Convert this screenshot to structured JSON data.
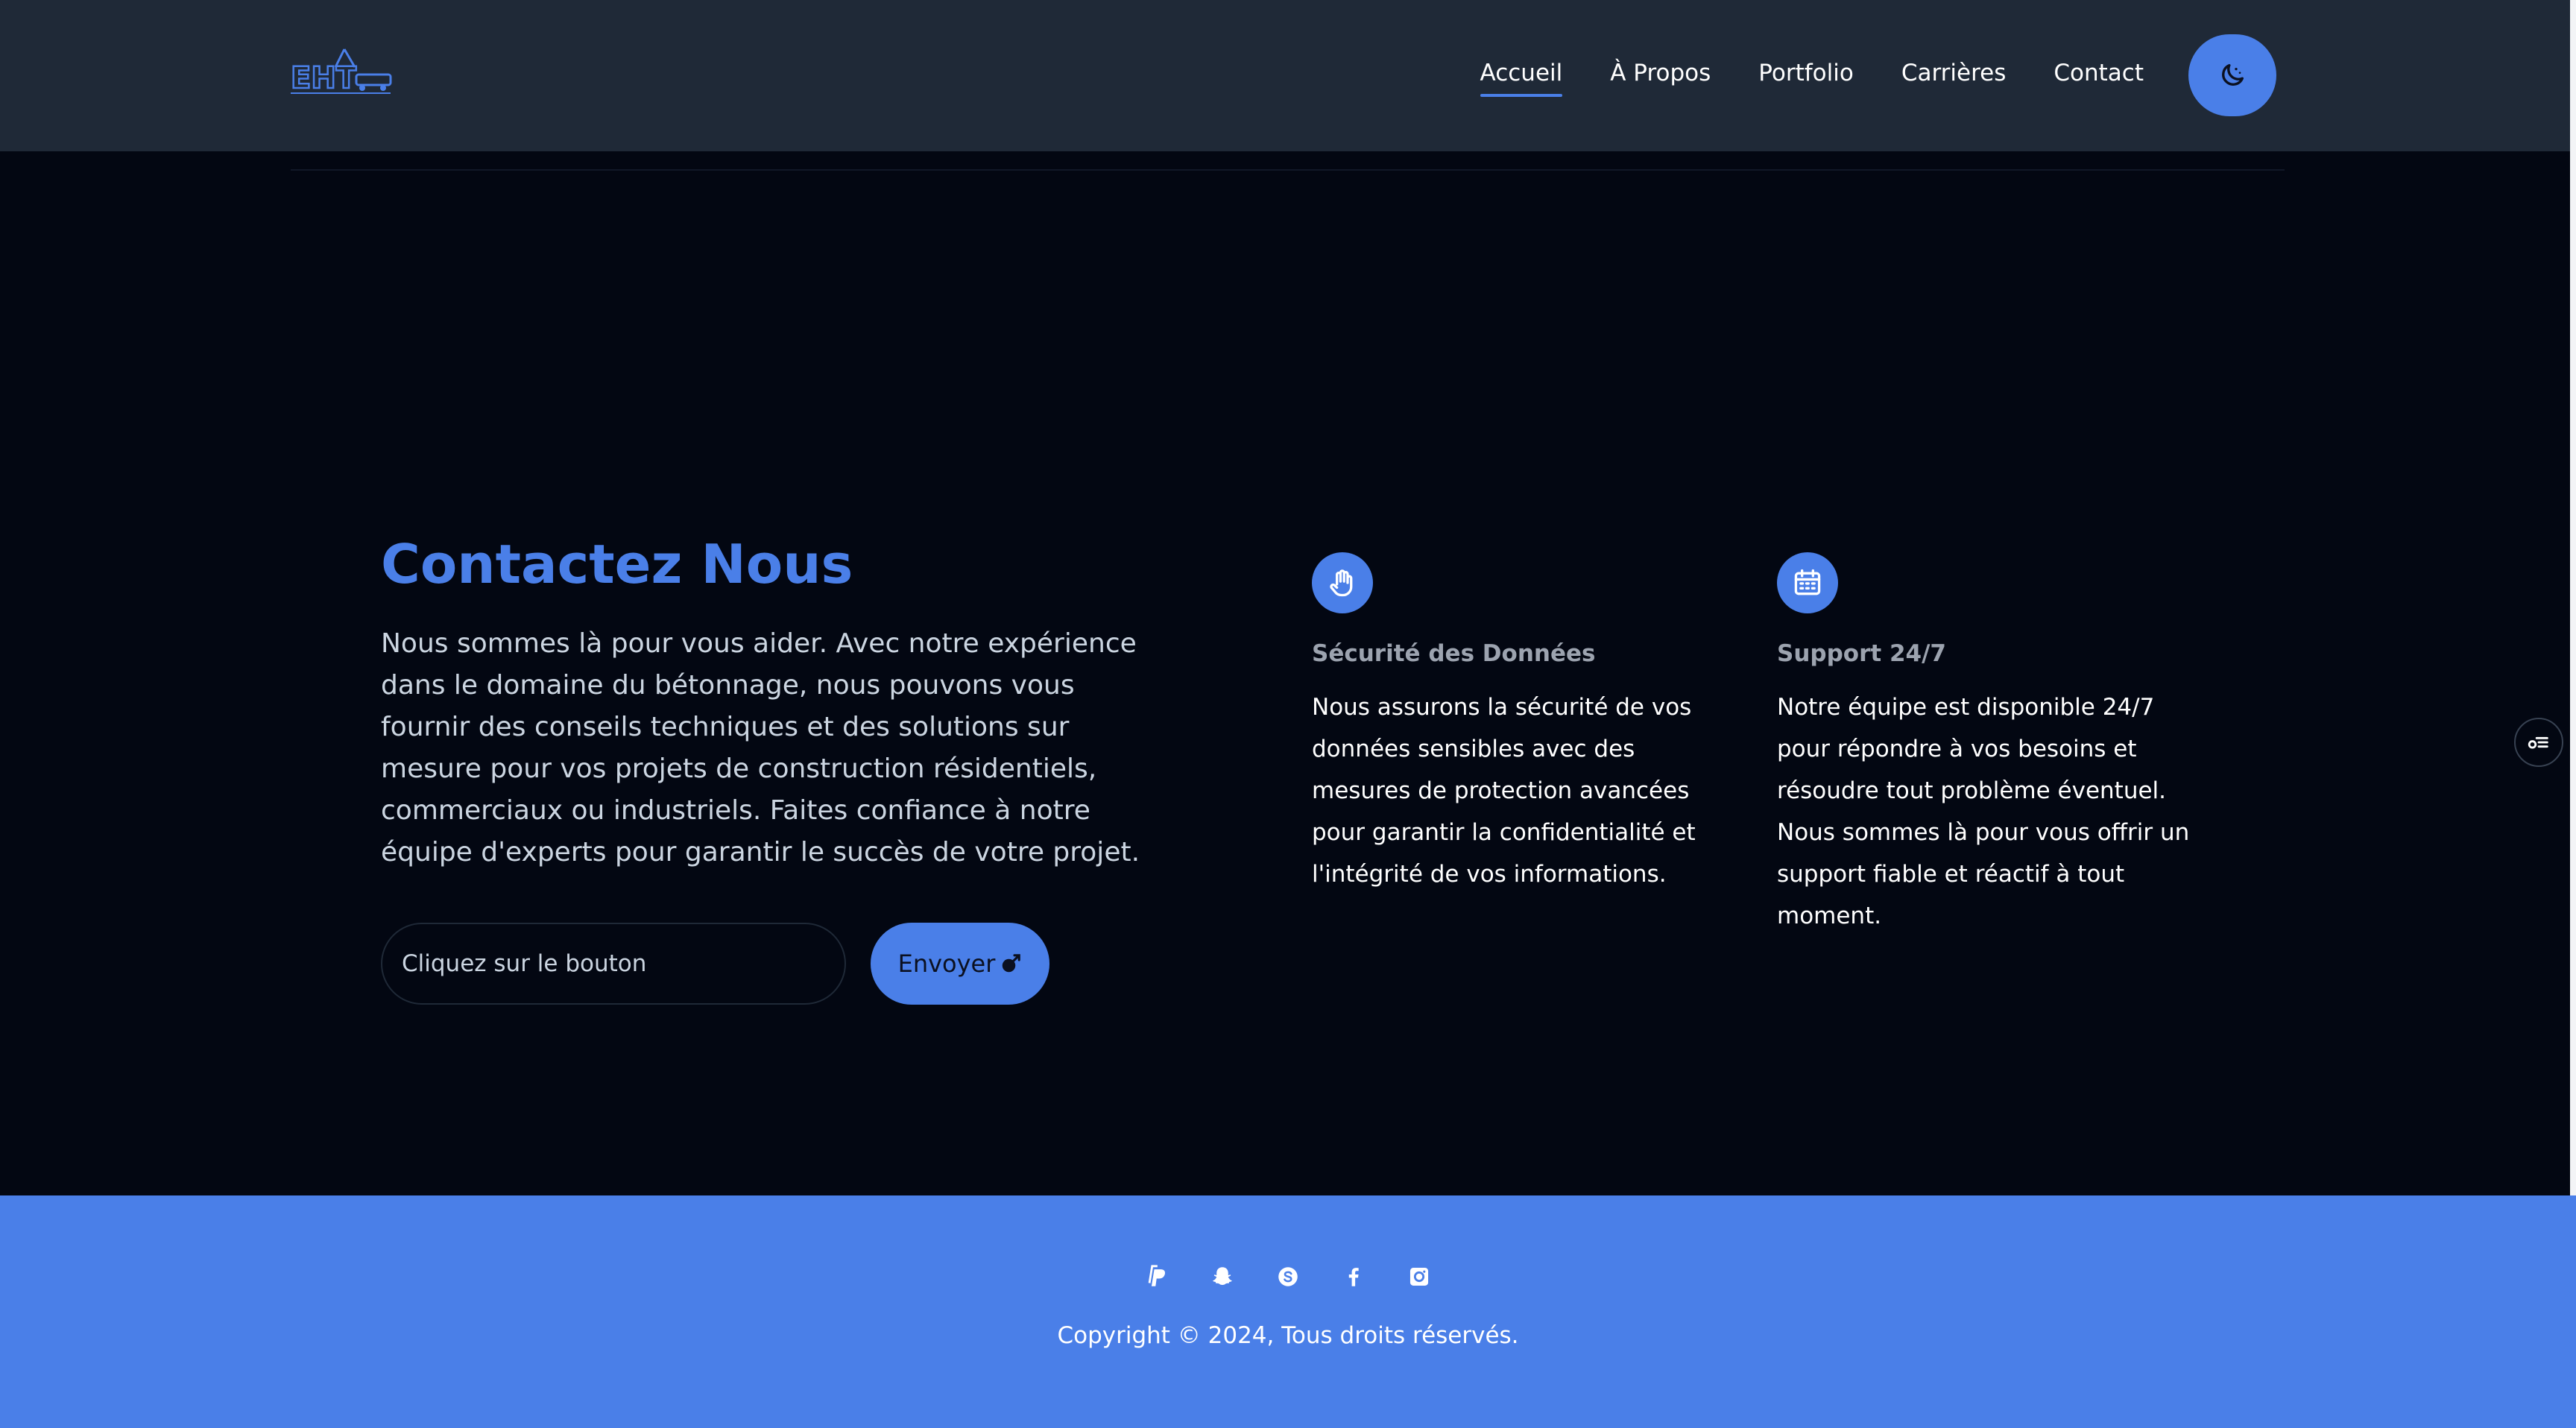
{
  "header": {
    "logo_alt": "EHT",
    "nav": [
      {
        "label": "Accueil",
        "active": true
      },
      {
        "label": "À Propos",
        "active": false
      },
      {
        "label": "Portfolio",
        "active": false
      },
      {
        "label": "Carrières",
        "active": false
      },
      {
        "label": "Contact",
        "active": false
      }
    ],
    "theme_toggle_icon": "moon-icon"
  },
  "contact": {
    "title": "Contactez Nous",
    "description": "Nous sommes là pour vous aider. Avec notre expérience dans le domaine du bétonnage, nous pouvons vous fournir des conseils techniques et des solutions sur mesure pour vos projets de construction résidentiels, commerciaux ou industriels. Faites confiance à notre équipe d'experts pour garantir le succès de votre projet.",
    "input_placeholder": "Cliquez sur le bouton",
    "send_label": "Envoyer"
  },
  "features": [
    {
      "icon": "hand-icon",
      "title": "Sécurité des Données",
      "text": "Nous assurons la sécurité de vos données sensibles avec des mesures de protection avancées pour garantir la confidentialité et l'intégrité de vos informations."
    },
    {
      "icon": "calendar-icon",
      "title": "Support 24/7",
      "text": "Notre équipe est disponible 24/7 pour répondre à vos besoins et résoudre tout problème éventuel. Nous sommes là pour vous offrir un support fiable et réactif à tout moment."
    }
  ],
  "footer": {
    "socials": [
      "paypal-icon",
      "snapchat-icon",
      "skype-icon",
      "facebook-icon",
      "instagram-icon"
    ],
    "copyright": "Copyright © 2024, Tous droits réservés."
  },
  "colors": {
    "accent": "#4a7fe8",
    "background": "#030712",
    "header": "#1f2937"
  }
}
